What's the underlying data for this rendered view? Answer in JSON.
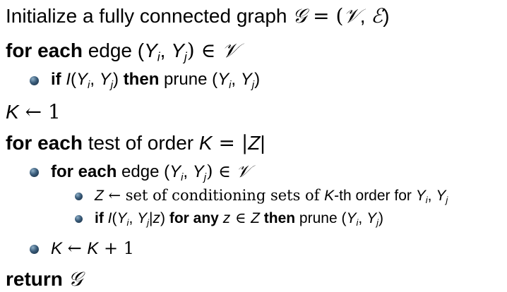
{
  "line1": {
    "text": "Initialize a fully connected graph ",
    "g": "𝒢",
    "eq": " = (",
    "v": "𝒱",
    "comma": ", ",
    "e": "ℰ",
    "close": ")"
  },
  "line2": {
    "kw": "for each",
    "text": " edge (",
    "yi": "Y",
    "i": "i",
    "sep": ", ",
    "yj": "Y",
    "j": "j",
    "rest": ") ∈ ",
    "v": "𝒱"
  },
  "line3": {
    "kw_if": "if",
    "I": "I",
    "paren": "(",
    "yi": "Y",
    "i": "i",
    "sep": ", ",
    "yj": "Y",
    "j": "j",
    "close": ") ",
    "kw_then": "then",
    "prune": " prune (",
    "yi2": "Y",
    "i2": "i",
    "sep2": ", ",
    "yj2": "Y",
    "j2": "j",
    "close2": ")"
  },
  "line4": {
    "k": "K",
    "arrow": " ← 1"
  },
  "line5": {
    "kw": "for each",
    "text": " test of order ",
    "k": "K",
    "eq": " = |",
    "z": "Z",
    "bar": "|"
  },
  "line6": {
    "kw": "for each",
    "text": " edge (",
    "yi": "Y",
    "i": "i",
    "sep": ", ",
    "yj": "Y",
    "j": "j",
    "rest": ") ∈ ",
    "v": "𝒱"
  },
  "line7": {
    "z": "Z",
    "text1": " ← set of conditioning sets of ",
    "k": "K",
    "text2": "-th order for ",
    "yi": "Y",
    "i": "i",
    "sep": ", ",
    "yj": "Y",
    "j": "j"
  },
  "line8": {
    "kw_if": "if",
    "I": "I",
    "paren": "(",
    "yi": "Y",
    "i": "i",
    "sep": ", ",
    "yj": "Y",
    "j": "j",
    "bar": "|",
    "z": "z",
    "close": ") ",
    "kw_for": "for any",
    "z2": "z",
    "in": " ∈ ",
    "Z": "Z",
    "space": " ",
    "kw_then": "then",
    "prune": " prune (",
    "yi2": "Y",
    "i2": "i",
    "sep2": ", ",
    "yj2": "Y",
    "j2": "j",
    "close2": ")"
  },
  "line9": {
    "k": "K",
    "arrow": " ← ",
    "k2": "K",
    "plus": " + 1"
  },
  "line10": {
    "kw": "return",
    "space": " ",
    "g": "𝒢"
  }
}
